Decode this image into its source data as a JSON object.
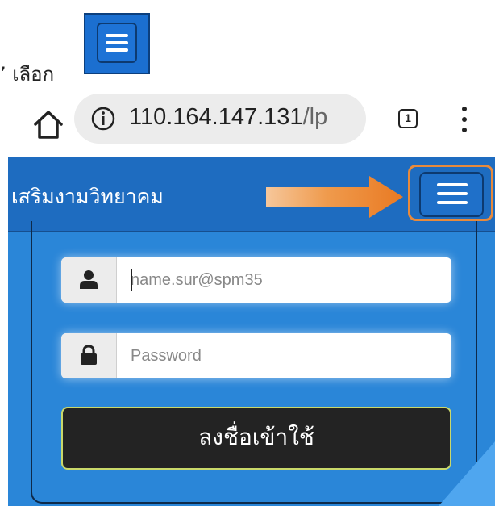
{
  "instruction": {
    "text": "’ เลือก"
  },
  "browser": {
    "url_host": "110.164.147.131",
    "url_path": "/lp",
    "tab_count": "1"
  },
  "site": {
    "brand": "เสริมงามวิทยาคม",
    "username": {
      "placeholder": "name.sur@spm35"
    },
    "password": {
      "placeholder": "Password"
    },
    "login_label": "ลงชื่อเข้าใช้"
  },
  "colors": {
    "navbar": "#1e6cc0",
    "page_bg": "#2a86d8",
    "highlight": "#e88a3c",
    "login_button": "#232323"
  }
}
